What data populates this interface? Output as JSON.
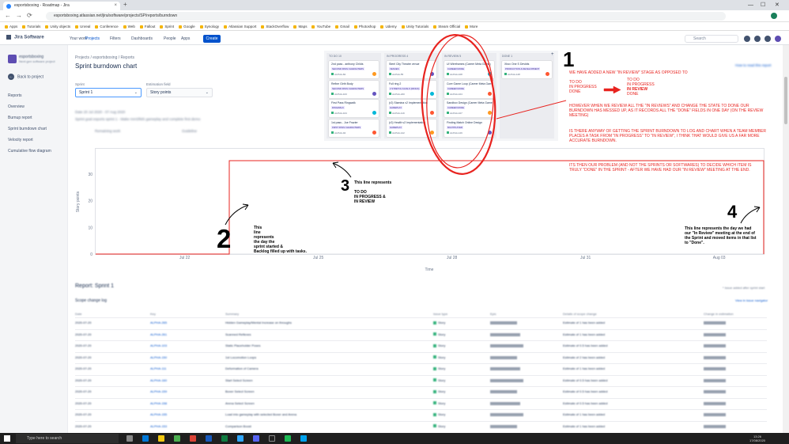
{
  "browser": {
    "tab_title": "esportsboxing - Roadmap - Jira",
    "tab_close": "×",
    "new_tab": "+",
    "url": "esportsboxing.atlassian.net/jira/software/projects/SP/reports/burndown",
    "bookmarks": [
      "Apps",
      "Tutorials",
      "Unity objects",
      "Unreal",
      "Conference",
      "Web",
      "Fallout",
      "Sprint",
      "Google",
      "Synology",
      "Atlassian Support",
      "StackOverflow",
      "Maps",
      "YouTube",
      "Gmail",
      "Photoshop",
      "Udemy",
      "Unity Tutorials",
      "Steam Official",
      "More"
    ],
    "minimize": "—",
    "maximize": "☐",
    "close": "✕",
    "back": "←",
    "forward": "→",
    "reload": "⟳"
  },
  "jira_nav": {
    "logo": "Jira Software",
    "menu": [
      "Your work",
      "Projects",
      "Filters",
      "Dashboards",
      "People",
      "Apps"
    ],
    "create": "Create",
    "search_placeholder": "Search"
  },
  "sidebar": {
    "project_name": "esportsboxing",
    "project_sub": "Next-gen software project",
    "back": "Back to project",
    "back_arrow": "←",
    "section": "Reports",
    "items": [
      "Overview",
      "Burnup report",
      "Sprint burndown chart",
      "Velocity report",
      "Cumulative flow diagram"
    ]
  },
  "header": {
    "breadcrumb": "Projects  /  esportsboxing  /  Reports",
    "title": "Sprint burndown chart",
    "sprint_label": "Sprint",
    "sprint_value": "Sprint 1",
    "estimation_label": "Estimation field",
    "estimation_value": "Story points",
    "chevron": "⌄",
    "dates": "Date  20 Jul 2020 - 07 Aug 2020",
    "goal": "Sprint goal  esports sprint 1 - Make mmSfMS gameplay and complete first demo",
    "remaining_label": "Remaining work",
    "guideline_label": "Guideline",
    "how_to": "How to read this report"
  },
  "board": {
    "add": "+",
    "columns": [
      {
        "name": "TO DO  10",
        "cards": [
          {
            "title": "2nd pass - anthony Childs",
            "tag": "SECOND PASS CHARACTERS",
            "key": "ALPHA-84"
          },
          {
            "title": "Refine Girth Body",
            "tag": "SECOND PASS CHARACTERS",
            "key": "ALPHA-103"
          },
          {
            "title": "First Pass Ringwalk",
            "tag": "RINGWALK",
            "key": "ALPHA-104"
          },
          {
            "title": "1st pass - Joe Frazier",
            "tag": "FIRST PASS CHARACTERS",
            "key": "ALPHA-94"
          }
        ]
      },
      {
        "name": "IN PROGRESS  4",
        "cards": [
          {
            "title": "Steel City Theatre venue",
            "tag": "VENUES",
            "key": "ALPHA-55"
          },
          {
            "title": "Full ring 2",
            "tag": "2 STRETCH GOALS (RINGS)",
            "key": "ALPHA-220"
          },
          {
            "title": "(r2) Stamina v2 Implementation",
            "tag": "GAMEPLAY",
            "key": "ALPHA-119"
          },
          {
            "title": "(r2) Health v2 Implementation",
            "tag": "GAMEPLAY",
            "key": "ALPHA-122"
          }
        ]
      },
      {
        "name": "IN REVIEW  5",
        "cards": [
          {
            "title": "UI Wireframes (Career Meta Game)",
            "tag": "CAREER MODE",
            "key": "ALPHA-108"
          },
          {
            "title": "Core Game Loop (Career Meta Game)",
            "tag": "CAREER MODE",
            "key": "ALPHA-104"
          },
          {
            "title": "Sandbox Design (Career Meta Game)",
            "tag": "CAREER MODE",
            "key": "ALPHA-107"
          },
          {
            "title": "Finding Match Online Design",
            "tag": "MULTIPLAYER",
            "key": "ALPHA-129"
          }
        ]
      },
      {
        "name": "DONE  1",
        "cards": [
          {
            "title": "Xbox One S Devkits",
            "tag": "PRODUCTION & DEVELOPMENT",
            "key": "ALPHA-128"
          }
        ]
      }
    ]
  },
  "chart_data": {
    "type": "line",
    "title": "",
    "xlabel": "Time",
    "ylabel": "Story points",
    "x_ticks": [
      "Jul 22",
      "Jul 25",
      "Jul 28",
      "Jul 31",
      "Aug 03"
    ],
    "y_ticks": [
      0,
      10,
      20,
      30
    ],
    "ylim": [
      0,
      35
    ],
    "series": [
      {
        "values": [
          {
            "x": "Jul 20",
            "y": 0
          },
          {
            "x": "Jul 23",
            "y": 0
          },
          {
            "x": "Jul 23",
            "y": 35
          },
          {
            "x": "Aug 04",
            "y": 35
          },
          {
            "x": "Aug 04",
            "y": 0
          }
        ]
      }
    ],
    "grid": false,
    "line_color": "#e8231f"
  },
  "annotations": {
    "n1": "1",
    "n2": "2",
    "n3": "3",
    "n4": "4",
    "top_intro": "WE HAVE ADDED A NEW \"IN REVIEW\" STAGE AS OPPOSED TO",
    "old_flow": [
      "TO DO",
      "IN PROGRESS",
      "DONE"
    ],
    "new_flow": [
      "TO DO",
      "IN PROGRESS",
      "IN REVIEW",
      "DONE"
    ],
    "however": "HOWEVER WHEN WE REVIEW ALL THE \"IN REVIEWS\" AND CHANGE THE STATE TO DONE OUR BURNDOWN HAS MESSED UP, AS IT RECORDS ALL THE \"DONE\" FIELDS IN ONE DAY (ON THE REVIEW MEETING)",
    "question": "IS THERE ANYWAY OF GETTING THE SPRINT BURNDOWN TO LOG AND CHART WHEN A TEAM MEMBER PLACES A TASK FROM \"IN PROGRESS\" TO \"IN REVIEW\", I THINK THAT WOULD GIVE US A FAR MORE ACCURATE BURNDOWN.",
    "problem": "ITS THEN OUR PROBLEM (AND NOT THE SPRINTS OR SOFTWARES) TO DECIDE WHICH ITEM IS TRULY \"DONE\" IN THE SPRINT - AFTER WE HAVE HAD OUR \"IN REVIEW\" MEETING AT THE END.",
    "line3_title": "This line represents",
    "line3_items": [
      "TO DO",
      "IN PROGRESS &",
      "IN REVIEW"
    ],
    "line2_text": [
      "This",
      "line",
      "represents",
      "the day the",
      "sprint started &",
      "Backlog filled up with tasks."
    ],
    "line4_text": [
      "This  line represents the day we had",
      "our \"In Review\" meeting at the end of",
      "the Sprint and moved items in that list",
      "to \"Done\"."
    ]
  },
  "report": {
    "title": "Report: Sprint 1",
    "note": "* Issue added after sprint start",
    "scope_title": "Scope change log",
    "scope_link": "View in Issue navigator",
    "headers": [
      "Date",
      "Key",
      "Summary",
      "Issue type",
      "Epic",
      "Details of scope change",
      "Change in estimation"
    ],
    "rows": [
      {
        "date": "2020-07-20",
        "key": "ALPHA-265",
        "summary": "Hidden Gameplay/Mental Increase on throughs",
        "type": "Story",
        "detail": "Estimate of 1 has been added"
      },
      {
        "date": "2020-07-20",
        "key": "ALPHA-261",
        "summary": "Scanned Reflexes",
        "type": "Story",
        "detail": "Estimate of 1 has been added"
      },
      {
        "date": "2020-07-20",
        "key": "ALPHA-103",
        "summary": "Static Placeholder Poses",
        "type": "Story",
        "detail": "Estimate of 0.5 has been added"
      },
      {
        "date": "2020-07-20",
        "key": "ALPHA-150",
        "summary": "1st Locomotion Loops",
        "type": "Story",
        "detail": "Estimate of 2 has been added"
      },
      {
        "date": "2020-07-20",
        "key": "ALPHA-111",
        "summary": "Deformation of Camera",
        "type": "Story",
        "detail": "Estimate of 1 has been added"
      },
      {
        "date": "2020-07-20",
        "key": "ALPHA-160",
        "summary": "Start Select Screen",
        "type": "Story",
        "detail": "Estimate of 0.5 has been added"
      },
      {
        "date": "2020-07-20",
        "key": "ALPHA-159",
        "summary": "Boxer Select Screen",
        "type": "Story",
        "detail": "Estimate of 0.5 has been added"
      },
      {
        "date": "2020-07-20",
        "key": "ALPHA-158",
        "summary": "Arena Select Screen",
        "type": "Story",
        "detail": "Estimate of 0.5 has been added"
      },
      {
        "date": "2020-07-20",
        "key": "ALPHA-155",
        "summary": "Load into gameplay with selected Boxer and Arena",
        "type": "Story",
        "detail": "Estimate of 1 has been added"
      },
      {
        "date": "2020-07-20",
        "key": "ALPHA-153",
        "summary": "Comparison Boost",
        "type": "Story",
        "detail": "Estimate of 1 has been added"
      }
    ]
  },
  "taskbar": {
    "search": "Type here to search",
    "time": "13:26",
    "date": "17/08/2020"
  }
}
